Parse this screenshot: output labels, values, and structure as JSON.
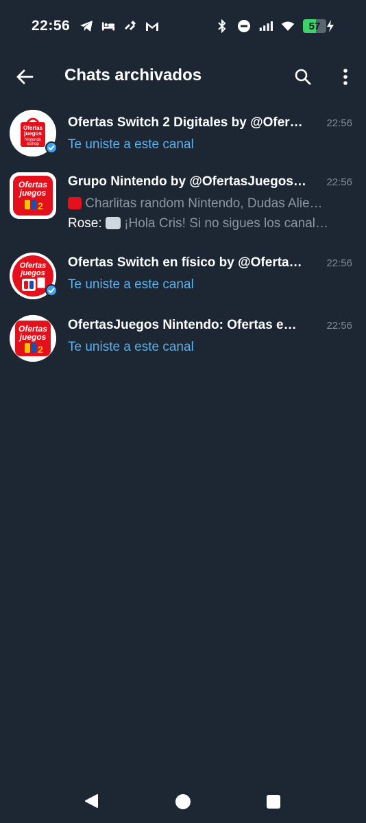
{
  "status_bar": {
    "time": "22:56",
    "left_icons": [
      "telegram-icon",
      "bed-icon",
      "tidal-icon",
      "gmail-icon"
    ],
    "right_icons": [
      "bluetooth-icon",
      "do-not-disturb-icon",
      "signal-icon",
      "wifi-icon"
    ],
    "battery_level": "57",
    "battery_fraction": 0.57,
    "battery_color": "#3fd16b"
  },
  "app_bar": {
    "title": "Chats archivados",
    "back_icon": "arrow-back-icon",
    "search_icon": "search-icon",
    "menu_icon": "more-vertical-icon"
  },
  "chats": [
    {
      "title": "Ofertas Switch 2 Digitales by @Ofer…",
      "time": "22:56",
      "subtitle": "Te uniste a este canal",
      "avatar_icon": "eshop-bag-icon",
      "verified": true
    },
    {
      "title": "Grupo Nintendo by @OfertasJuegos…",
      "time": "22:56",
      "line1": "Charlitas random Nintendo,  Dudas Alie…",
      "sender": "Rose:",
      "line2": "¡Hola Cris!   Si no sigues los canal…",
      "avatar_icon": "ofertas-juegos-logo-icon",
      "verified": false
    },
    {
      "title": "Ofertas Switch en físico by @Oferta…",
      "time": "22:56",
      "subtitle": "Te uniste a este canal",
      "avatar_icon": "switch-physical-icon",
      "verified": true
    },
    {
      "title": "OfertasJuegos Nintendo: Ofertas e…",
      "time": "22:56",
      "subtitle": "Te uniste a este canal",
      "avatar_icon": "ofertas-juegos-logo-icon",
      "verified": false
    }
  ],
  "avatar_text": {
    "ofertas": "Ofertas",
    "juegos": "juegos",
    "nintendo": "Nintendo",
    "eshop": "eShop"
  },
  "colors": {
    "background": "#1d2733",
    "link": "#5eb0ea",
    "muted": "#8b96a1",
    "brand_red": "#e4101b",
    "brand_blue": "#1e4fa8"
  },
  "nav_bar": {
    "back_icon": "nav-back-triangle-icon",
    "home_icon": "nav-home-circle-icon",
    "recent_icon": "nav-recent-square-icon"
  }
}
